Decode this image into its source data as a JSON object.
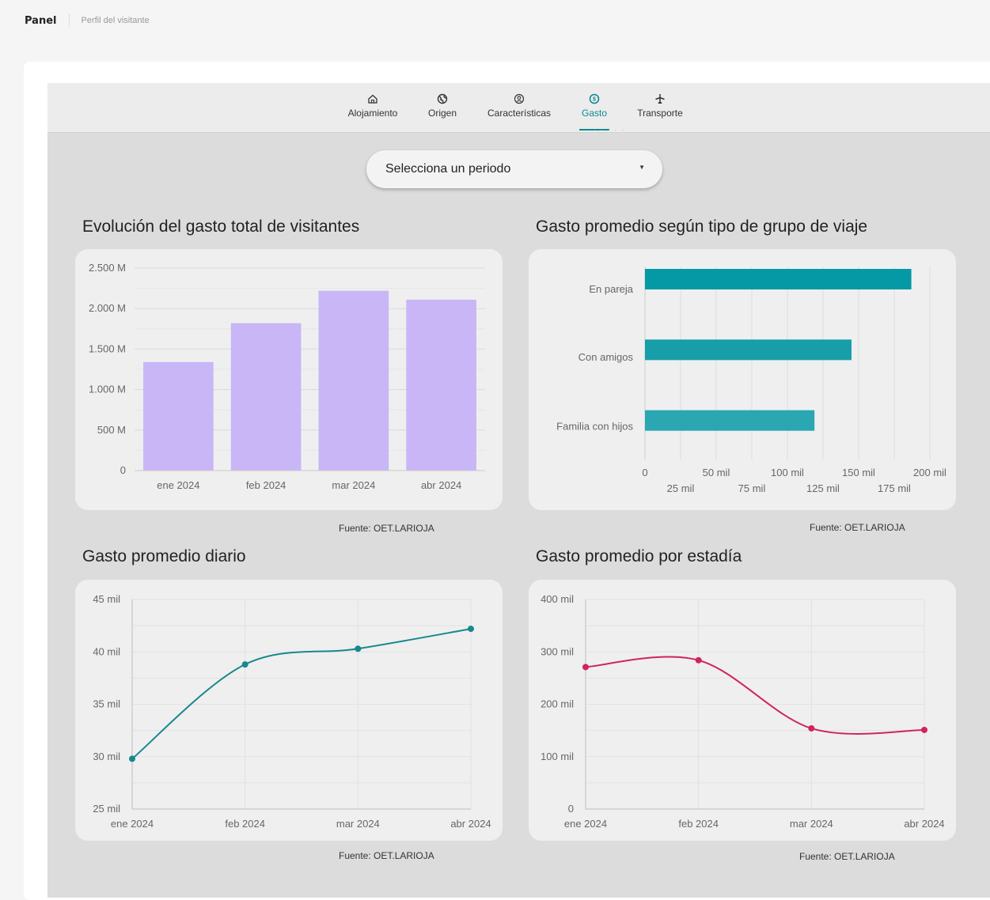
{
  "breadcrumb": {
    "root": "Panel",
    "current": "Perfil del visitante"
  },
  "tabs": [
    {
      "label": "Alojamiento",
      "icon": "home-icon",
      "active": false
    },
    {
      "label": "Origen",
      "icon": "globe-icon",
      "active": false
    },
    {
      "label": "Características",
      "icon": "person-circle-icon",
      "active": false
    },
    {
      "label": "Gasto",
      "icon": "money-icon",
      "active": true
    },
    {
      "label": "Transporte",
      "icon": "airplane-icon",
      "active": false
    }
  ],
  "period_select": {
    "value": "Selecciona un periodo"
  },
  "colors": {
    "accent": "#0e8a92",
    "bar_purple": "#c8b6f7",
    "line_teal": "#16888f",
    "line_pink": "#d0245e",
    "hbar": [
      "#0599a5",
      "#179ea8",
      "#2aa7b1"
    ]
  },
  "charts": {
    "total": {
      "title": "Evolución del gasto total de visitantes",
      "source": "Fuente: OET.LARIOJA"
    },
    "group": {
      "title": "Gasto promedio según tipo de grupo de viaje",
      "source": "Fuente: OET.LARIOJA"
    },
    "daily": {
      "title": "Gasto promedio diario",
      "source": "Fuente: OET.LARIOJA"
    },
    "stay": {
      "title": "Gasto promedio por estadía",
      "source": "Fuente: OET.LARIOJA"
    }
  },
  "chart_data": [
    {
      "type": "bar",
      "title": "Evolución del gasto total de visitantes",
      "categories": [
        "ene 2024",
        "feb 2024",
        "mar 2024",
        "abr 2024"
      ],
      "values": [
        1340,
        1820,
        2220,
        2110
      ],
      "ylim": [
        0,
        2500
      ],
      "yticks": [
        0,
        500,
        1000,
        1500,
        2000,
        2500
      ],
      "ytick_labels": [
        "0",
        "500 M",
        "1.000 M",
        "1.500 M",
        "2.000 M",
        "2.500 M"
      ],
      "grid": true
    },
    {
      "type": "bar",
      "orientation": "horizontal",
      "title": "Gasto promedio según tipo de grupo de viaje",
      "categories": [
        "En pareja",
        "Con amigos",
        "Familia con hijos"
      ],
      "values": [
        187,
        145,
        119
      ],
      "xlim": [
        0,
        200
      ],
      "xticks": [
        0,
        25,
        50,
        75,
        100,
        125,
        150,
        175,
        200
      ],
      "xtick_labels": [
        "0",
        "25 mil",
        "50 mil",
        "75 mil",
        "100 mil",
        "125 mil",
        "150 mil",
        "175 mil",
        "200 mil"
      ],
      "grid": true
    },
    {
      "type": "line",
      "title": "Gasto promedio diario",
      "x": [
        "ene 2024",
        "feb 2024",
        "mar 2024",
        "abr 2024"
      ],
      "values": [
        29.8,
        38.8,
        40.3,
        42.2
      ],
      "ylim": [
        25,
        45
      ],
      "yticks": [
        25,
        30,
        35,
        40,
        45
      ],
      "ytick_labels": [
        "25 mil",
        "30 mil",
        "35 mil",
        "40 mil",
        "45 mil"
      ],
      "grid": true
    },
    {
      "type": "line",
      "title": "Gasto promedio por estadía",
      "x": [
        "ene 2024",
        "feb 2024",
        "mar 2024",
        "abr 2024"
      ],
      "values": [
        271,
        284,
        154,
        151
      ],
      "ylim": [
        0,
        400
      ],
      "yticks": [
        0,
        100,
        200,
        300,
        400
      ],
      "ytick_labels": [
        "0",
        "100 mil",
        "200 mil",
        "300 mil",
        "400 mil"
      ],
      "grid": true
    }
  ]
}
